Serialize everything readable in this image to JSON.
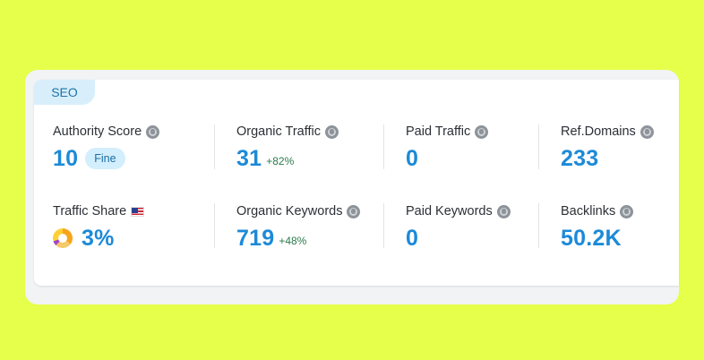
{
  "section_tab": "SEO",
  "metrics": {
    "authority_score": {
      "label": "Authority Score",
      "value": "10",
      "badge": "Fine"
    },
    "organic_traffic": {
      "label": "Organic Traffic",
      "value": "31",
      "delta": "+82%"
    },
    "paid_traffic": {
      "label": "Paid Traffic",
      "value": "0"
    },
    "ref_domains": {
      "label": "Ref.Domains",
      "value": "233"
    },
    "traffic_share": {
      "label": "Traffic Share",
      "value": "3%"
    },
    "organic_keywords": {
      "label": "Organic Keywords",
      "value": "719",
      "delta": "+48%"
    },
    "paid_keywords": {
      "label": "Paid Keywords",
      "value": "0"
    },
    "backlinks": {
      "label": "Backlinks",
      "value": "50.2K"
    }
  },
  "colors": {
    "background": "#e6ff4a",
    "value_blue": "#1c8ad8",
    "delta_green": "#2b7a4b",
    "badge_bg": "#d3eefc"
  },
  "icons": {
    "info": "globe-icon",
    "country": "us-flag-icon",
    "share_chart": "donut-chart-icon"
  }
}
